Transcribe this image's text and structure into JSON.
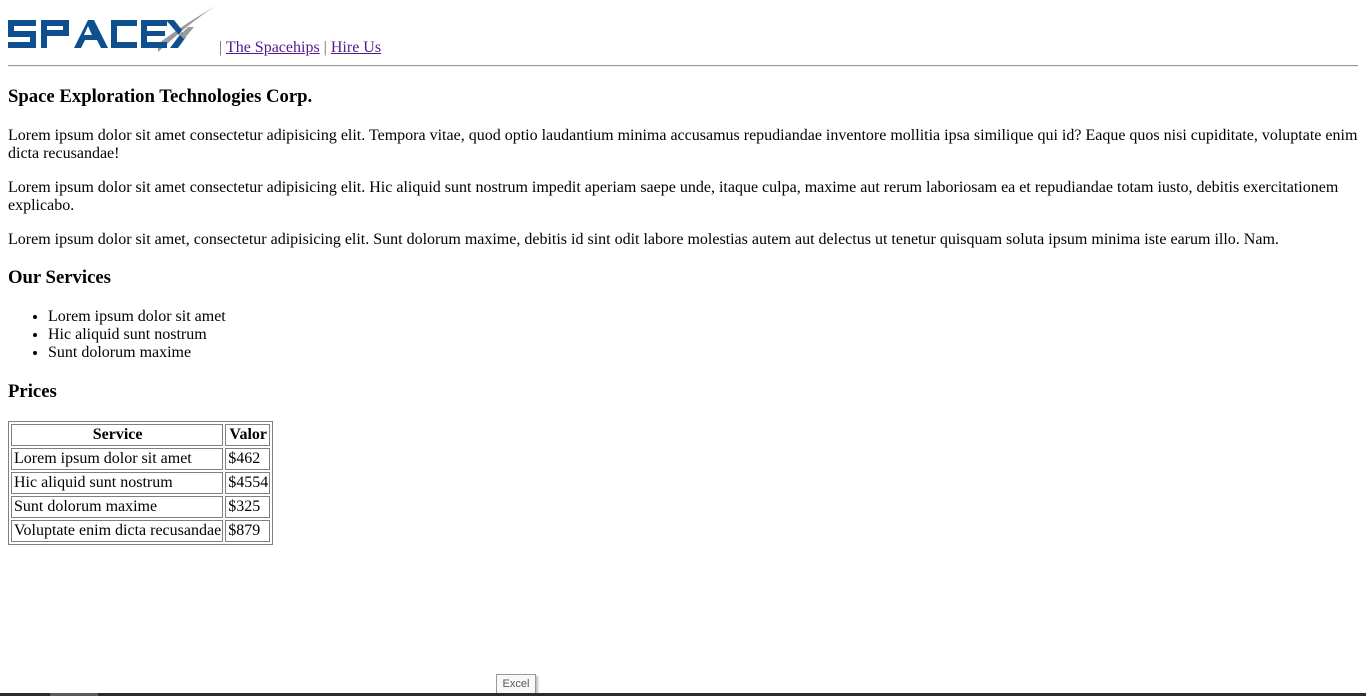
{
  "header": {
    "logo_text": "SPACEX",
    "separator": "|",
    "nav": [
      {
        "label": "The Spacehips"
      },
      {
        "label": "Hire Us"
      }
    ]
  },
  "colors": {
    "logo_blue": "#0e4f8f",
    "logo_swoosh": "#9a9a9a",
    "visited_link": "#551a8b"
  },
  "main": {
    "title": "Space Exploration Technologies Corp.",
    "paragraphs": [
      "Lorem ipsum dolor sit amet consectetur adipisicing elit. Tempora vitae, quod optio laudantium minima accusamus repudiandae inventore mollitia ipsa similique qui id? Eaque quos nisi cupiditate, voluptate enim dicta recusandae!",
      "Lorem ipsum dolor sit amet consectetur adipisicing elit. Hic aliquid sunt nostrum impedit aperiam saepe unde, itaque culpa, maxime aut rerum laboriosam ea et repudiandae totam iusto, debitis exercitationem explicabo.",
      "Lorem ipsum dolor sit amet, consectetur adipisicing elit. Sunt dolorum maxime, debitis id sint odit labore molestias autem aut delectus ut tenetur quisquam soluta ipsum minima iste earum illo. Nam."
    ],
    "services": {
      "heading": "Our Services",
      "items": [
        "Lorem ipsum dolor sit amet",
        "Hic aliquid sunt nostrum",
        "Sunt dolorum maxime"
      ]
    },
    "prices": {
      "heading": "Prices",
      "columns": [
        "Service",
        "Valor"
      ],
      "rows": [
        [
          "Lorem ipsum dolor sit amet",
          "$462"
        ],
        [
          "Hic aliquid sunt nostrum",
          "$4554"
        ],
        [
          "Sunt dolorum maxime",
          "$325"
        ],
        [
          "Voluptate enim dicta recusandae",
          "$879"
        ]
      ]
    }
  },
  "tooltip": {
    "text": "Excel"
  }
}
